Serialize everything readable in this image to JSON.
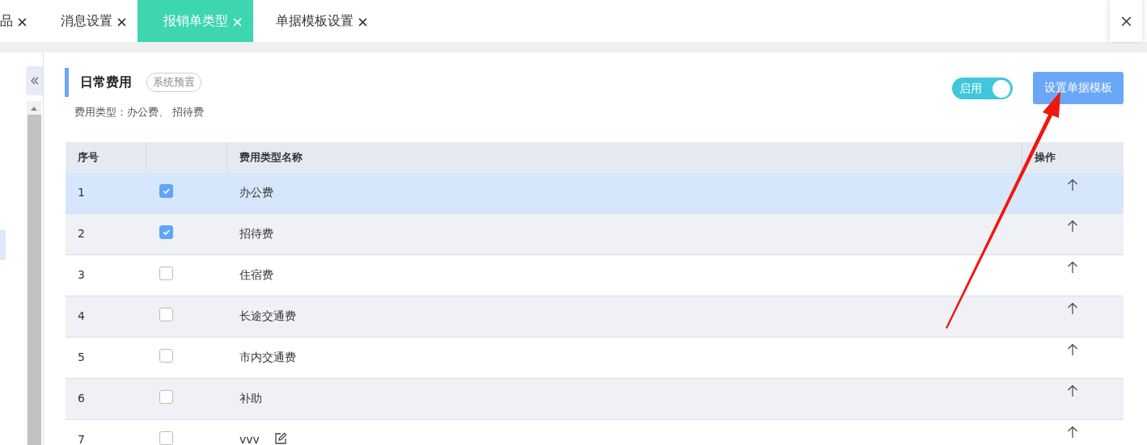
{
  "tabs": [
    {
      "label": "品",
      "selected": false
    },
    {
      "label": "消息设置",
      "selected": false
    },
    {
      "label": "报销单类型",
      "selected": true
    },
    {
      "label": "单据模板设置",
      "selected": false
    }
  ],
  "section": {
    "title": "日常费用",
    "badge": "系统预置",
    "subtitle": "费用类型：办公费、 招待费",
    "toggle": {
      "label": "启用",
      "on": true
    },
    "button": "设置单据模板"
  },
  "table": {
    "columns": [
      "序号",
      "",
      "费用类型名称",
      "操作"
    ],
    "rows": [
      {
        "index": "1",
        "checked": true,
        "name": "办公费",
        "selected": true,
        "editable": false
      },
      {
        "index": "2",
        "checked": true,
        "name": "招待费",
        "selected": false,
        "editable": false
      },
      {
        "index": "3",
        "checked": false,
        "name": "住宿费",
        "selected": false,
        "editable": false
      },
      {
        "index": "4",
        "checked": false,
        "name": "长途交通费",
        "selected": false,
        "editable": false
      },
      {
        "index": "5",
        "checked": false,
        "name": "市内交通费",
        "selected": false,
        "editable": false
      },
      {
        "index": "6",
        "checked": false,
        "name": "补助",
        "selected": false,
        "editable": false
      },
      {
        "index": "7",
        "checked": false,
        "name": "vvv",
        "selected": false,
        "editable": true
      }
    ]
  }
}
